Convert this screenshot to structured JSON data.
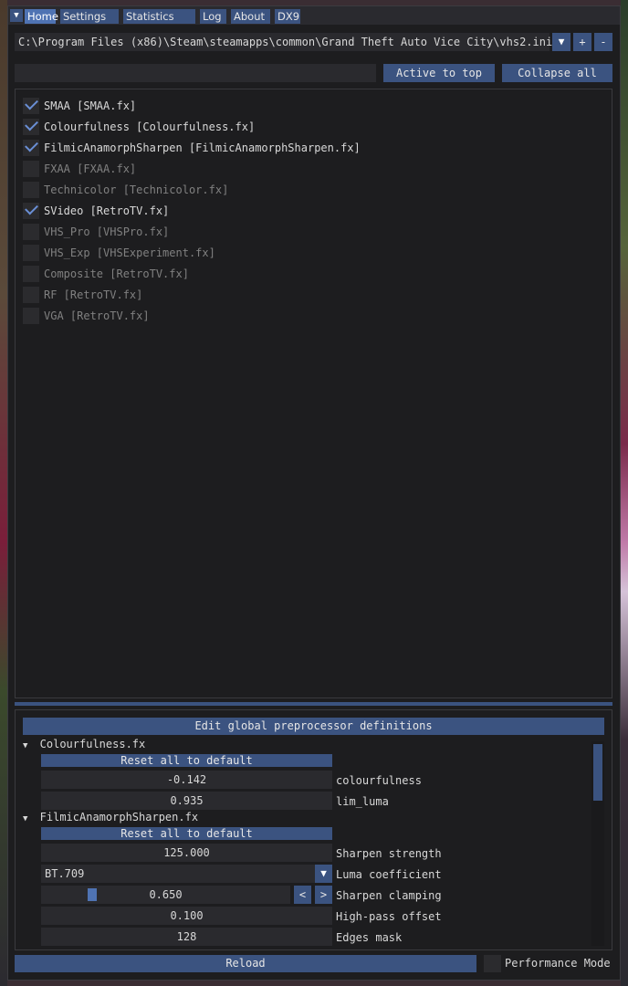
{
  "tabs": [
    "Home",
    "Settings",
    "Statistics",
    "Log",
    "About",
    "DX9"
  ],
  "preset": {
    "path": "C:\\Program Files (x86)\\Steam\\steamapps\\common\\Grand Theft Auto Vice City\\vhs2.ini",
    "add_label": "+",
    "remove_label": "-"
  },
  "toolbar": {
    "active_to_top_label": "Active to top",
    "collapse_all_label": "Collapse all"
  },
  "effects": [
    {
      "name": "SMAA [SMAA.fx]",
      "enabled": true
    },
    {
      "name": "Colourfulness [Colourfulness.fx]",
      "enabled": true
    },
    {
      "name": "FilmicAnamorphSharpen [FilmicAnamorphSharpen.fx]",
      "enabled": true
    },
    {
      "name": "FXAA [FXAA.fx]",
      "enabled": false
    },
    {
      "name": "Technicolor [Technicolor.fx]",
      "enabled": false
    },
    {
      "name": "SVideo [RetroTV.fx]",
      "enabled": true
    },
    {
      "name": "VHS_Pro [VHSPro.fx]",
      "enabled": false
    },
    {
      "name": "VHS_Exp [VHSExperiment.fx]",
      "enabled": false
    },
    {
      "name": "Composite [RetroTV.fx]",
      "enabled": false
    },
    {
      "name": "RF [RetroTV.fx]",
      "enabled": false
    },
    {
      "name": "VGA [RetroTV.fx]",
      "enabled": false
    }
  ],
  "params": {
    "edit_preprocessor_label": "Edit global preprocessor definitions",
    "colourfulness": {
      "header": "Colourfulness.fx",
      "reset_label": "Reset all to default",
      "colourfulness_value": "-0.142",
      "colourfulness_label": "colourfulness",
      "lim_luma_value": "0.935",
      "lim_luma_label": "lim_luma"
    },
    "filmic": {
      "header": "FilmicAnamorphSharpen.fx",
      "reset_label": "Reset all to default",
      "strength_value": "125.000",
      "strength_label": "Sharpen strength",
      "luma_coef_value": "BT.709",
      "luma_coef_label": "Luma coefficient",
      "clamping_value": "0.650",
      "clamping_label": "Sharpen clamping",
      "clamping_level": 0.65,
      "dec_label": "<",
      "inc_label": ">",
      "offset_value": "0.100",
      "offset_label": "High-pass offset",
      "edges_value": "128",
      "edges_label": "Edges mask"
    }
  },
  "footer": {
    "reload_label": "Reload",
    "performance_mode_label": "Performance Mode",
    "performance_mode": false
  },
  "colors": {
    "accent": "#4f73b3",
    "button": "#3b5380",
    "window_bg": "#1d1d1f",
    "check": "#6a8fd6"
  }
}
